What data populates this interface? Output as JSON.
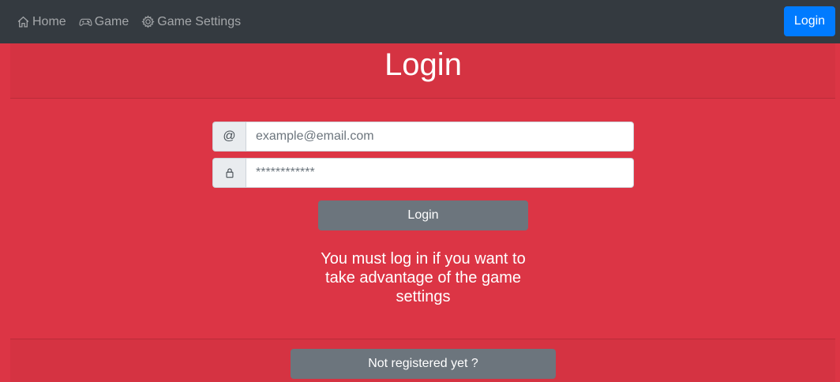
{
  "navbar": {
    "links": [
      {
        "label": "Home",
        "icon": "house-icon"
      },
      {
        "label": "Game",
        "icon": "gamepad-icon"
      },
      {
        "label": "Game Settings",
        "icon": "gear-icon"
      }
    ],
    "login_label": "Login",
    "login_color": "#007bff",
    "background": "#343a40"
  },
  "page": {
    "background": "#dc3545",
    "title": "Login"
  },
  "form": {
    "email": {
      "prepend": "@",
      "placeholder": "example@email.com",
      "value": ""
    },
    "password": {
      "prepend_icon": "lock-icon",
      "value": "************"
    },
    "submit_label": "Login",
    "message": "You must log in if you want to take advantage of the game settings"
  },
  "footer": {
    "register_label": "Not registered yet ?"
  }
}
